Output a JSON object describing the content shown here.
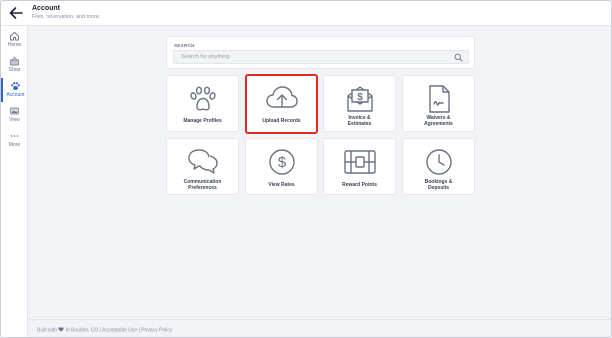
{
  "header": {
    "title": "Account",
    "subtitle": "Files, reservation, and more."
  },
  "sidebar": {
    "items": [
      {
        "label": "Home",
        "icon": "home-icon"
      },
      {
        "label": "Shop",
        "icon": "shop-icon"
      },
      {
        "label": "Account",
        "icon": "paw-icon",
        "active": true
      },
      {
        "label": "View",
        "icon": "view-icon"
      },
      {
        "label": "More",
        "icon": "more-icon"
      }
    ]
  },
  "search": {
    "label": "SEARCH",
    "placeholder": "Search for anything",
    "value": ""
  },
  "tiles": [
    {
      "label_line1": "Manage Profiles",
      "label_line2": "",
      "icon": "paw-icon"
    },
    {
      "label_line1": "Upload Records",
      "label_line2": "",
      "icon": "cloud-upload-icon",
      "highlighted": true
    },
    {
      "label_line1": "Invoice &",
      "label_line2": "Estimates",
      "icon": "invoice-dollar-icon"
    },
    {
      "label_line1": "Waivers &",
      "label_line2": "Agreements",
      "icon": "document-sign-icon"
    },
    {
      "label_line1": "Communication",
      "label_line2": "Preferences",
      "icon": "chat-bubbles-icon"
    },
    {
      "label_line1": "View Rates",
      "label_line2": "",
      "icon": "dollar-circle-icon"
    },
    {
      "label_line1": "Reward Points",
      "label_line2": "",
      "icon": "reward-box-icon"
    },
    {
      "label_line1": "Bookings &",
      "label_line2": "Deposits",
      "icon": "clock-icon"
    }
  ],
  "footer": {
    "built_with": "Built with",
    "location": "in Boulder, CO |",
    "acceptable_use": "Acceptable Use",
    "separator": "|",
    "privacy": "Privacy Policy"
  },
  "colors": {
    "accent": "#2f64c8",
    "highlight": "#e32626",
    "icon": "#6b7285"
  }
}
